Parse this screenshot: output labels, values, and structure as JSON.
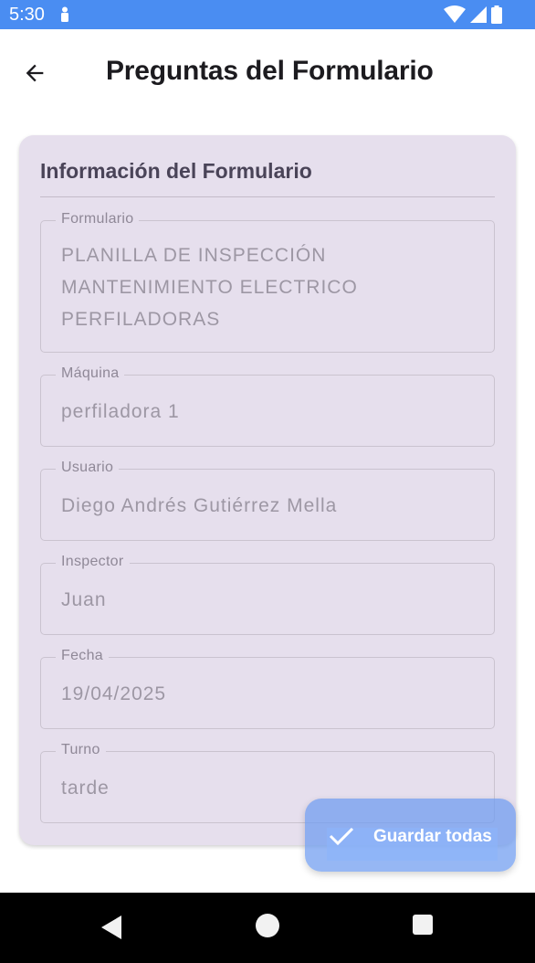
{
  "status_bar": {
    "time": "5:30",
    "left_icon": "accessibility-icon",
    "right_icons": [
      "wifi-icon",
      "signal-icon",
      "battery-icon"
    ],
    "color": "#4a8df2"
  },
  "app_bar": {
    "back_icon": "arrow-back-icon",
    "title": "Preguntas del Formulario"
  },
  "card": {
    "title": "Información del Formulario",
    "background": "#e6dfed",
    "fields": [
      {
        "label": "Formulario",
        "value": "PLANILLA DE INSPECCIÓN MANTENIMIENTO ELECTRICO PERFILADORAS"
      },
      {
        "label": "Máquina",
        "value": "perfiladora 1"
      },
      {
        "label": "Usuario",
        "value": "Diego Andrés Gutiérrez Mella"
      },
      {
        "label": "Inspector",
        "value": "Juan"
      },
      {
        "label": "Fecha",
        "value": "19/04/2025"
      },
      {
        "label": "Turno",
        "value": "tarde"
      }
    ]
  },
  "fab": {
    "icon": "check-icon",
    "label": "Guardar todas"
  },
  "nav_bar": {
    "icons": [
      "nav-back-icon",
      "nav-home-icon",
      "nav-recents-icon"
    ]
  }
}
